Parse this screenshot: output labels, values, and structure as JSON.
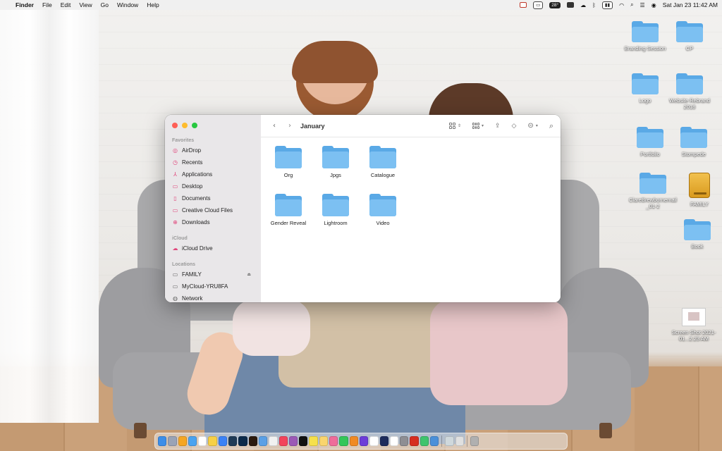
{
  "menubar": {
    "app_name": "Finder",
    "menus": [
      "File",
      "Edit",
      "View",
      "Go",
      "Window",
      "Help"
    ],
    "status_items": {
      "temperature": "28°",
      "datetime": "Sat Jan 23  11:42 AM"
    }
  },
  "desktop_icons": [
    {
      "label": "Branding Session",
      "kind": "folder"
    },
    {
      "label": "CP",
      "kind": "folder"
    },
    {
      "label": "Logo",
      "kind": "folder"
    },
    {
      "label": "Website Rebrand 2018",
      "kind": "folder"
    },
    {
      "label": "Portfolio",
      "kind": "folder"
    },
    {
      "label": "Stompede",
      "kind": "folder"
    },
    {
      "label": "ClareBrewbornemail_01-2",
      "kind": "folder"
    },
    {
      "label": "FAMILY",
      "kind": "drive"
    },
    {
      "label": "Book",
      "kind": "folder"
    },
    {
      "label": "Screen Shot 2021-01...2.23 AM",
      "kind": "screenshot"
    }
  ],
  "finder": {
    "title": "January",
    "sidebar": {
      "favorites_header": "Favorites",
      "favorites": [
        {
          "label": "AirDrop",
          "icon": "airdrop-icon"
        },
        {
          "label": "Recents",
          "icon": "clock-icon"
        },
        {
          "label": "Applications",
          "icon": "applications-icon"
        },
        {
          "label": "Desktop",
          "icon": "desktop-icon"
        },
        {
          "label": "Documents",
          "icon": "document-icon"
        },
        {
          "label": "Creative Cloud Files",
          "icon": "folder-icon"
        },
        {
          "label": "Downloads",
          "icon": "download-icon"
        }
      ],
      "icloud_header": "iCloud",
      "icloud": [
        {
          "label": "iCloud Drive",
          "icon": "cloud-icon"
        }
      ],
      "locations_header": "Locations",
      "locations": [
        {
          "label": "FAMILY",
          "icon": "drive-icon"
        },
        {
          "label": "MyCloud-YRU8FA",
          "icon": "monitor-icon"
        },
        {
          "label": "Network",
          "icon": "network-icon"
        }
      ]
    },
    "items": [
      {
        "label": "Org"
      },
      {
        "label": "Jpgs"
      },
      {
        "label": "Catalogue"
      },
      {
        "label": "Gender Reveal"
      },
      {
        "label": "Lightroom"
      },
      {
        "label": "Video"
      }
    ]
  },
  "colors": {
    "folder_light": "#7cc0f2",
    "folder_dark": "#5aa9e6",
    "sidebar_accent": "#e0457b",
    "close": "#fe5f57",
    "minimize": "#febc2e",
    "zoom": "#28c840"
  },
  "dock_apps": [
    "finder-icon",
    "launchpad-icon",
    "photos-icon",
    "mail-icon",
    "calendar-icon",
    "notes-icon",
    "safari-icon",
    "lightroom-classic-icon",
    "photoshop-icon",
    "bridge-icon",
    "safari-alt-icon",
    "chrome-icon",
    "music-icon",
    "podcasts-icon",
    "appletv-icon",
    "sd-icon",
    "notes-alt-icon",
    "photos-alt-icon",
    "messages-icon",
    "pages-icon",
    "affinity-icon",
    "m-icon",
    "disney-icon",
    "notion-icon",
    "settings-icon",
    "acrobat-icon",
    "facetime-icon",
    "files-icon",
    "screenshot-1-icon",
    "screenshot-2-icon",
    "trash-icon"
  ]
}
